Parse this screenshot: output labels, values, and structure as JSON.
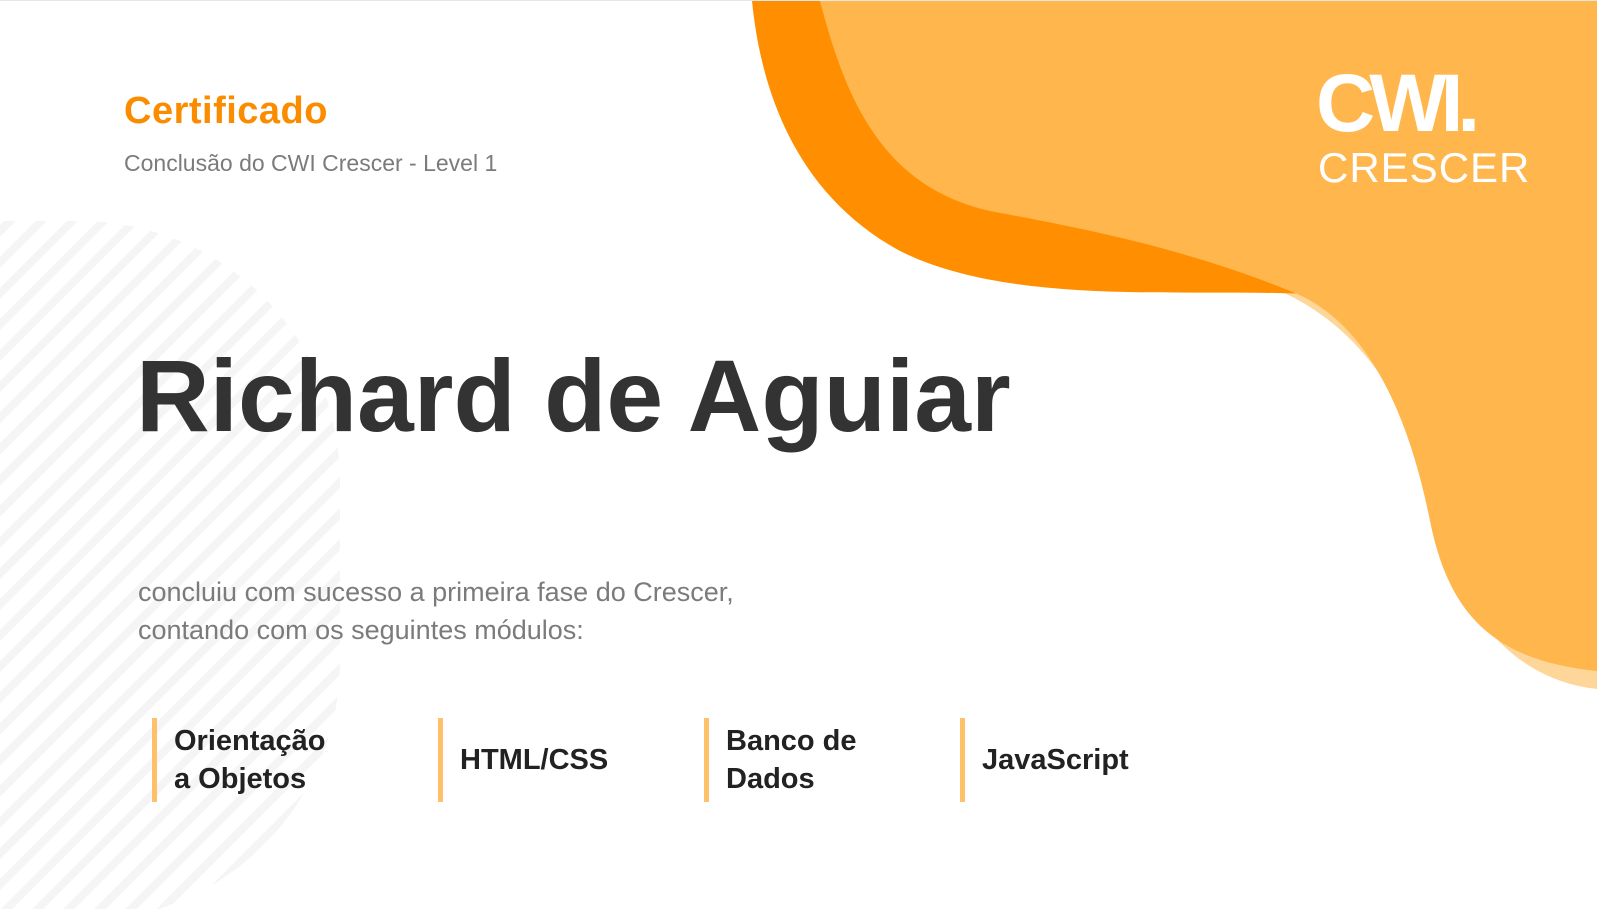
{
  "certificate": {
    "title": "Certificado",
    "subtitle": "Conclusão do CWI Crescer - Level 1",
    "recipient": "Richard de Aguiar",
    "description_line1": "concluiu com sucesso a primeira fase do Crescer,",
    "description_line2": "contando com os seguintes módulos:"
  },
  "logo": {
    "mark": "CWI.",
    "word": "CRESCER"
  },
  "modules": [
    {
      "line1": "Orientação",
      "line2": "a Objetos"
    },
    {
      "line1": "HTML/CSS"
    },
    {
      "line1": "Banco de",
      "line2": "Dados"
    },
    {
      "line1": "JavaScript"
    }
  ],
  "colors": {
    "accent_orange": "#fb8c00",
    "blob_dark": "#ff8f00",
    "blob_mid": "#ffb74d",
    "blob_light": "#ffd699",
    "module_bar": "#ffc06a",
    "name_text": "#333333",
    "muted_text": "#7b7b7b"
  }
}
